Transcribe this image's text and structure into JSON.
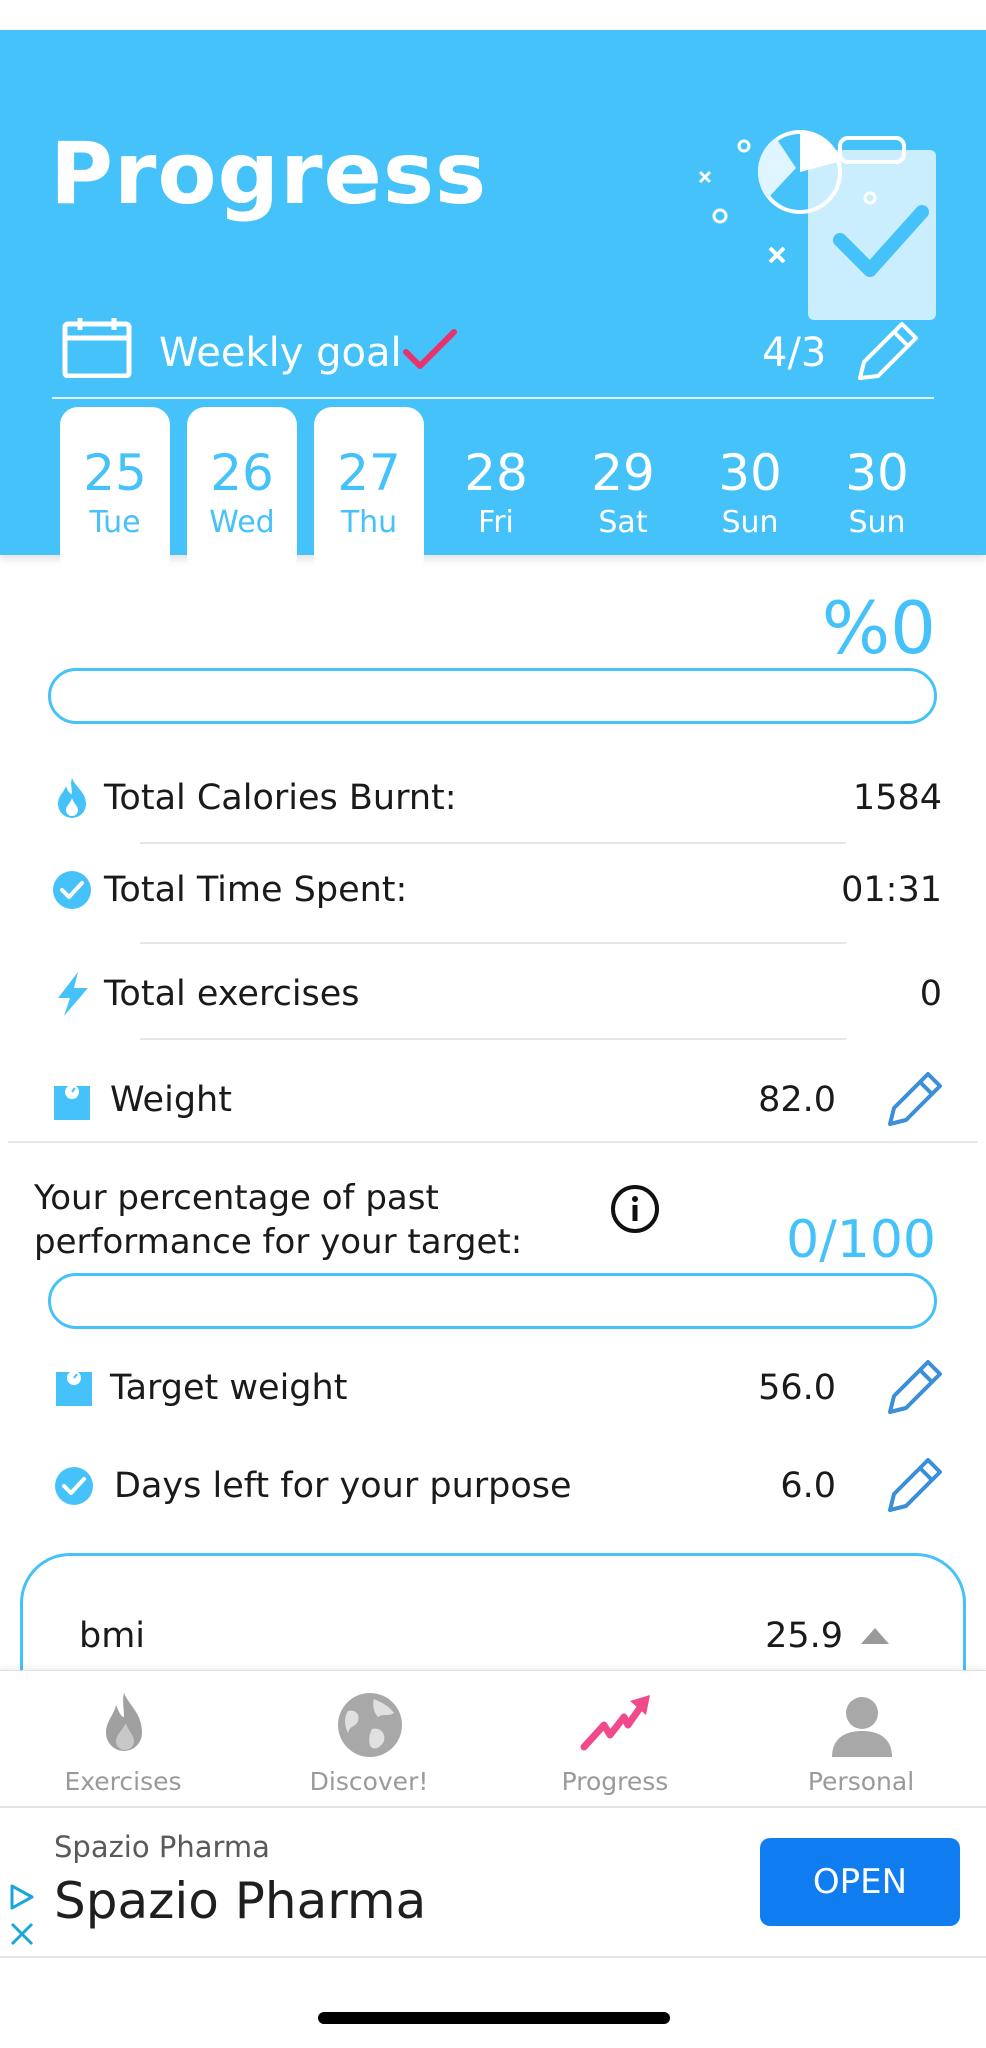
{
  "header": {
    "title": "Progress",
    "weekly_goal_label": "Weekly goal",
    "weekly_goal_count": "4/3",
    "days": [
      {
        "num": "25",
        "name": "Tue",
        "active": true
      },
      {
        "num": "26",
        "name": "Wed",
        "active": true
      },
      {
        "num": "27",
        "name": "Thu",
        "active": true
      },
      {
        "num": "28",
        "name": "Fri",
        "active": false
      },
      {
        "num": "29",
        "name": "Sat",
        "active": false
      },
      {
        "num": "30",
        "name": "Sun",
        "active": false
      },
      {
        "num": "30",
        "name": "Sun",
        "active": false
      }
    ]
  },
  "progress": {
    "percent_text": "%0",
    "percent_value": 0
  },
  "stats": {
    "calories_label": "Total Calories Burnt:",
    "calories_value": "1584",
    "time_label": "Total Time Spent:",
    "time_value": "01:31",
    "exercises_label": "Total exercises",
    "exercises_value": "0",
    "weight_label": "Weight",
    "weight_value": "82.0"
  },
  "past_performance": {
    "text": "Your percentage of past performance for your target:",
    "value_text": "0/100",
    "value": 0
  },
  "target": {
    "target_weight_label": "Target weight",
    "target_weight_value": "56.0",
    "days_left_label": "Days left for your purpose",
    "days_left_value": "6.0"
  },
  "bmi": {
    "label": "bmi",
    "value": "25.9"
  },
  "bottom_nav": {
    "items": [
      {
        "label": "Exercises",
        "icon": "flame-icon"
      },
      {
        "label": "Discover!",
        "icon": "globe-icon"
      },
      {
        "label": "Progress",
        "icon": "trend-icon",
        "active": true
      },
      {
        "label": "Personal",
        "icon": "person-icon"
      }
    ]
  },
  "ad": {
    "advertiser": "Spazio Pharma",
    "headline": "Spazio Pharma",
    "cta": "OPEN"
  },
  "colors": {
    "accent": "#45c2fa",
    "check_pink": "#e8336e",
    "ad_button": "#0f7df0",
    "nav_inactive": "#9a9a9a"
  }
}
